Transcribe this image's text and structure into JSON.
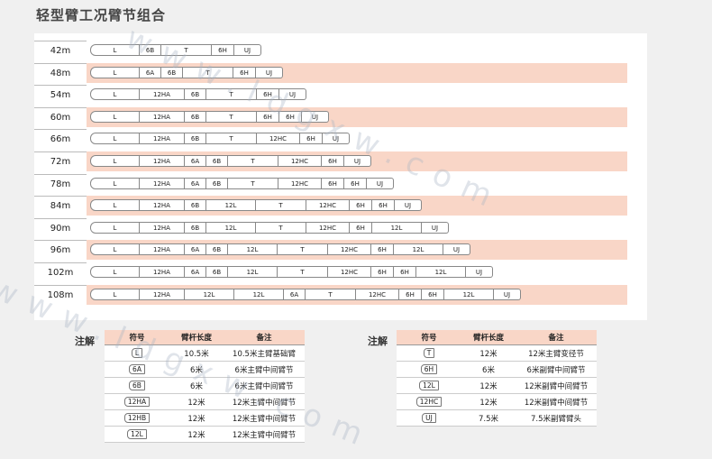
{
  "title": "轻型臂工况臂节组合",
  "watermark_text": "www.ldgxw.com",
  "rows": [
    {
      "length": "42m",
      "segments": [
        "L",
        "6B",
        "T",
        "6H",
        "UJ"
      ]
    },
    {
      "length": "48m",
      "segments": [
        "L",
        "6A",
        "6B",
        "T",
        "6H",
        "UJ"
      ]
    },
    {
      "length": "54m",
      "segments": [
        "L",
        "12HA",
        "6B",
        "T",
        "6H",
        "UJ"
      ]
    },
    {
      "length": "60m",
      "segments": [
        "L",
        "12HA",
        "6B",
        "T",
        "6H",
        "6H",
        "UJ"
      ]
    },
    {
      "length": "66m",
      "segments": [
        "L",
        "12HA",
        "6B",
        "T",
        "12HC",
        "6H",
        "UJ"
      ]
    },
    {
      "length": "72m",
      "segments": [
        "L",
        "12HA",
        "6A",
        "6B",
        "T",
        "12HC",
        "6H",
        "UJ"
      ]
    },
    {
      "length": "78m",
      "segments": [
        "L",
        "12HA",
        "6A",
        "6B",
        "T",
        "12HC",
        "6H",
        "6H",
        "UJ"
      ]
    },
    {
      "length": "84m",
      "segments": [
        "L",
        "12HA",
        "6B",
        "12L",
        "T",
        "12HC",
        "6H",
        "6H",
        "UJ"
      ]
    },
    {
      "length": "90m",
      "segments": [
        "L",
        "12HA",
        "6B",
        "12L",
        "T",
        "12HC",
        "6H",
        "12L",
        "UJ"
      ]
    },
    {
      "length": "96m",
      "segments": [
        "L",
        "12HA",
        "6A",
        "6B",
        "12L",
        "T",
        "12HC",
        "6H",
        "12L",
        "UJ"
      ]
    },
    {
      "length": "102m",
      "segments": [
        "L",
        "12HA",
        "6A",
        "6B",
        "12L",
        "T",
        "12HC",
        "6H",
        "6H",
        "12L",
        "UJ"
      ]
    },
    {
      "length": "108m",
      "segments": [
        "L",
        "12HA",
        "12L",
        "12L",
        "6A",
        "T",
        "12HC",
        "6H",
        "6H",
        "12L",
        "UJ"
      ]
    }
  ],
  "notes": {
    "label": "注解",
    "headers": [
      "符号",
      "臂杆长度",
      "备注"
    ],
    "left": [
      {
        "symbol": "L",
        "length": "10.5米",
        "remark": "10.5米主臂基础臂"
      },
      {
        "symbol": "6A",
        "length": "6米",
        "remark": "6米主臂中间臂节"
      },
      {
        "symbol": "6B",
        "length": "6米",
        "remark": "6米主臂中间臂节"
      },
      {
        "symbol": "12HA",
        "length": "12米",
        "remark": "12米主臂中间臂节"
      },
      {
        "symbol": "12HB",
        "length": "12米",
        "remark": "12米主臂中间臂节"
      },
      {
        "symbol": "12L",
        "length": "12米",
        "remark": "12米主臂中间臂节"
      }
    ],
    "right": [
      {
        "symbol": "T",
        "length": "12米",
        "remark": "12米主臂变径节"
      },
      {
        "symbol": "6H",
        "length": "6米",
        "remark": "6米副臂中间臂节"
      },
      {
        "symbol": "12L",
        "length": "12米",
        "remark": "12米副臂中间臂节"
      },
      {
        "symbol": "12HC",
        "length": "12米",
        "remark": "12米副臂中间臂节"
      },
      {
        "symbol": "UJ",
        "length": "7.5米",
        "remark": "7.5米副臂臂头"
      }
    ]
  }
}
